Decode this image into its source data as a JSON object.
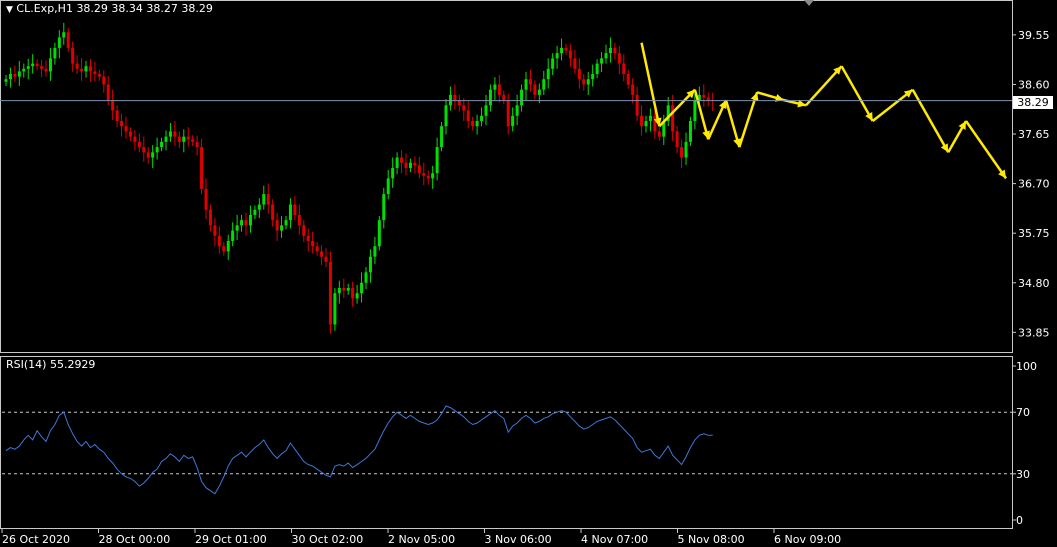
{
  "chart_header": {
    "symbol": "CL.Exp,H1",
    "ohlc": "38.29 38.34 38.27 38.29",
    "collapse_icon": "triangle-down-icon"
  },
  "rsi_header": {
    "label": "RSI(14) 55.2929"
  },
  "current_price": "38.29",
  "chart_data": [
    {
      "type": "candlestick",
      "timeframe": "H1",
      "price_ticks": [
        "39.55",
        "38.60",
        "37.65",
        "36.70",
        "35.75",
        "34.80",
        "33.85"
      ],
      "ylim": [
        33.55,
        39.95
      ],
      "x_labels": [
        "26 Oct 2020",
        "28 Oct 00:00",
        "29 Oct 01:00",
        "30 Oct 02:00",
        "2 Nov 05:00",
        "3 Nov 06:00",
        "4 Nov 07:00",
        "5 Nov 08:00",
        "6 Nov 09:00"
      ],
      "closes": [
        38.7,
        38.8,
        38.75,
        38.85,
        38.9,
        38.95,
        39.0,
        38.95,
        38.9,
        38.85,
        39.1,
        39.3,
        39.5,
        39.6,
        39.3,
        39.0,
        38.9,
        38.85,
        38.95,
        38.85,
        38.8,
        38.75,
        38.6,
        38.3,
        38.1,
        37.9,
        37.8,
        37.7,
        37.6,
        37.5,
        37.4,
        37.3,
        37.2,
        37.3,
        37.4,
        37.5,
        37.6,
        37.7,
        37.6,
        37.5,
        37.6,
        37.55,
        37.5,
        37.4,
        36.6,
        36.2,
        35.9,
        35.7,
        35.5,
        35.4,
        35.6,
        35.8,
        35.9,
        36.0,
        35.9,
        36.1,
        36.2,
        36.3,
        36.5,
        36.3,
        36.0,
        35.8,
        35.9,
        36.0,
        36.3,
        36.1,
        35.9,
        35.7,
        35.6,
        35.5,
        35.4,
        35.3,
        35.2,
        34.0,
        34.6,
        34.7,
        34.65,
        34.7,
        34.5,
        34.6,
        34.8,
        35.0,
        35.3,
        35.5,
        36.0,
        36.5,
        36.8,
        37.0,
        37.2,
        37.1,
        37.0,
        37.1,
        37.05,
        36.9,
        36.85,
        36.8,
        36.9,
        37.4,
        37.8,
        38.2,
        38.4,
        38.3,
        38.2,
        38.1,
        37.9,
        37.8,
        37.9,
        38.0,
        38.2,
        38.5,
        38.6,
        38.4,
        38.3,
        37.8,
        38.0,
        38.2,
        38.5,
        38.7,
        38.6,
        38.4,
        38.5,
        38.7,
        38.9,
        39.1,
        39.2,
        39.3,
        39.25,
        39.1,
        38.9,
        38.7,
        38.6,
        38.7,
        38.8,
        39.0,
        39.1,
        39.2,
        39.3,
        39.2,
        39.0,
        38.8,
        38.6,
        38.4,
        38.0,
        37.8,
        37.9,
        38.0,
        37.7,
        37.6,
        37.9,
        38.2,
        37.7,
        37.4,
        37.2,
        37.5,
        37.9,
        38.3,
        38.4,
        38.35,
        38.3,
        38.29
      ],
      "forecast_arrows": [
        {
          "from": [
            38.95,
            39.4
          ],
          "to": [
            147,
            37.8
          ]
        },
        {
          "from": [
            147,
            37.8
          ],
          "to": [
            155,
            38.5
          ]
        },
        {
          "from": [
            155,
            38.5
          ],
          "to": [
            158,
            37.55
          ]
        },
        {
          "from": [
            158,
            37.55
          ],
          "to": [
            162,
            38.3
          ]
        },
        {
          "from": [
            162,
            38.3
          ],
          "to": [
            165,
            37.4
          ]
        },
        {
          "from": [
            165,
            37.4
          ],
          "to": [
            169,
            38.45
          ]
        },
        {
          "from": [
            169,
            38.45
          ],
          "to": [
            175,
            38.3
          ]
        },
        {
          "from": [
            175,
            38.3
          ],
          "to": [
            180,
            38.2
          ]
        },
        {
          "from": [
            180,
            38.2
          ],
          "to": [
            188,
            38.95
          ]
        },
        {
          "from": [
            188,
            38.95
          ],
          "to": [
            195,
            37.9
          ]
        },
        {
          "from": [
            195,
            37.9
          ],
          "to": [
            204,
            38.5
          ]
        },
        {
          "from": [
            204,
            38.5
          ],
          "to": [
            212,
            37.3
          ]
        },
        {
          "from": [
            212,
            37.3
          ],
          "to": [
            216,
            37.9
          ]
        },
        {
          "from": [
            216,
            37.9
          ],
          "to": [
            225,
            36.8
          ]
        }
      ],
      "forecast_total_slots": 225
    },
    {
      "type": "line",
      "series": [
        {
          "name": "RSI(14)",
          "color": "#3c78d8"
        }
      ],
      "y_ticks": [
        "100",
        "70",
        "30",
        "0"
      ],
      "levels": [
        70,
        30
      ],
      "ylim": [
        0,
        100
      ],
      "values": [
        45,
        47,
        46,
        48,
        52,
        55,
        52,
        58,
        54,
        51,
        58,
        62,
        68,
        70,
        62,
        56,
        51,
        48,
        51,
        47,
        49,
        46,
        44,
        40,
        37,
        33,
        30,
        28,
        27,
        25,
        22,
        24,
        27,
        31,
        33,
        38,
        40,
        43,
        41,
        38,
        42,
        40,
        41,
        34,
        25,
        21,
        19,
        17,
        22,
        28,
        35,
        40,
        42,
        44,
        41,
        44,
        47,
        49,
        52,
        47,
        43,
        40,
        43,
        45,
        50,
        46,
        42,
        38,
        36,
        35,
        33,
        31,
        29,
        28,
        35,
        36,
        35,
        37,
        34,
        36,
        38,
        40,
        43,
        46,
        52,
        58,
        63,
        67,
        70,
        68,
        66,
        68,
        66,
        64,
        63,
        62,
        63,
        65,
        69,
        74,
        73,
        71,
        69,
        67,
        64,
        62,
        63,
        65,
        67,
        69,
        71,
        68,
        66,
        57,
        61,
        63,
        66,
        68,
        66,
        63,
        64,
        66,
        67,
        69,
        70,
        71,
        70,
        67,
        64,
        61,
        59,
        60,
        62,
        64,
        65,
        66,
        67,
        65,
        62,
        59,
        56,
        53,
        47,
        44,
        45,
        46,
        42,
        40,
        44,
        48,
        42,
        39,
        36,
        41,
        47,
        52,
        55,
        56,
        55,
        55
      ]
    }
  ]
}
